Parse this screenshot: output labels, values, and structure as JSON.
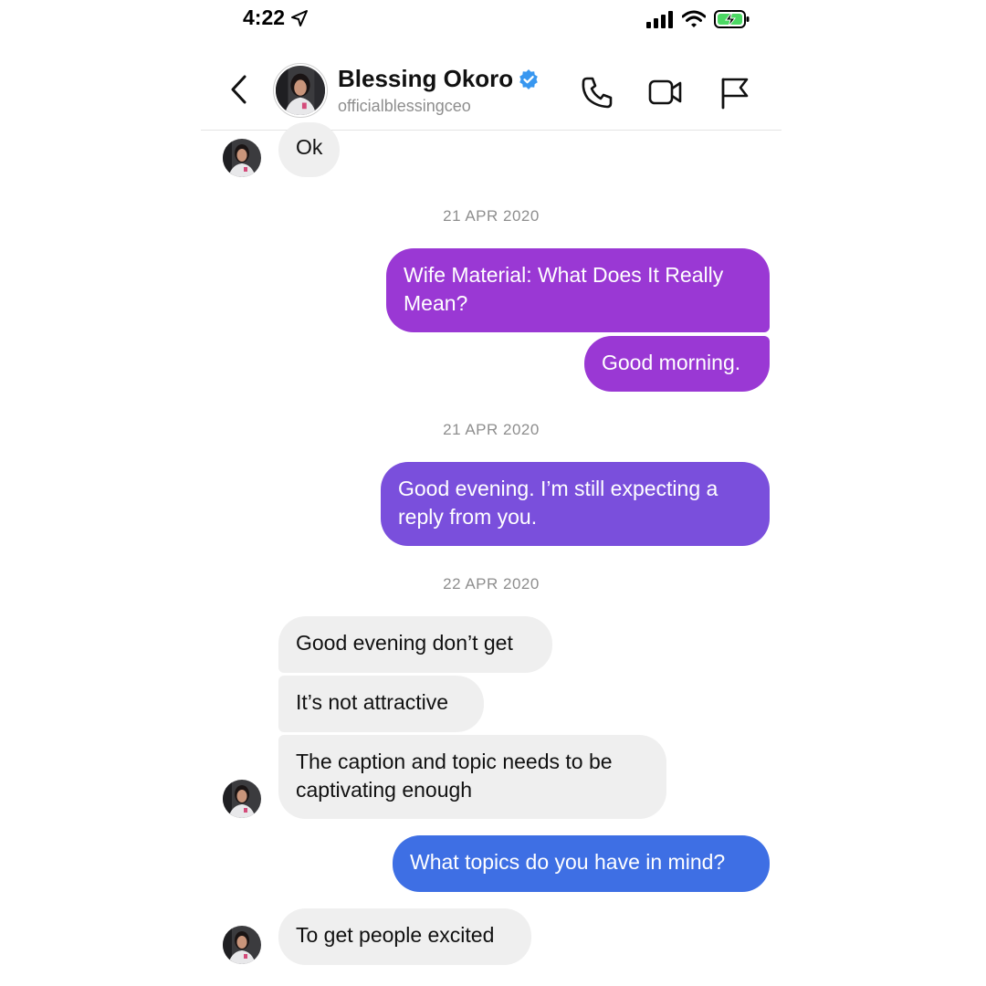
{
  "status_bar": {
    "time": "4:22"
  },
  "header": {
    "name": "Blessing Okoro",
    "username": "officialblessingceo"
  },
  "messages": {
    "m0": "Ok",
    "ts1": "21 APR 2020",
    "m1": "Wife Material: What Does It Really Mean?",
    "m2": "Good morning.",
    "ts2": "21 APR 2020",
    "m3": "Good evening. I’m still expecting a reply from you.",
    "ts3": "22 APR 2020",
    "m4": "Good evening don’t get",
    "m5": "It’s not attractive",
    "m6": "The caption and topic needs to be captivating enough",
    "m7": "What topics do you have in mind?",
    "m8": "To get people excited"
  },
  "colors": {
    "purple": "#9a38d4",
    "violet": "#7a4fdc",
    "blue": "#3e6fe4",
    "verified": "#3897f0",
    "incoming": "#efefef"
  }
}
